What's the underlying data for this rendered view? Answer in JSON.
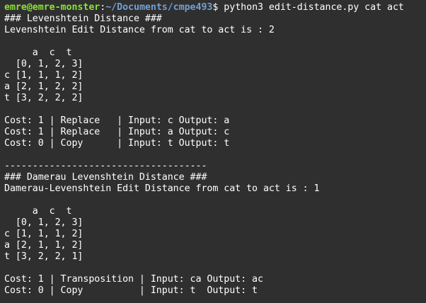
{
  "prompt": {
    "user_host": "emre@emre-monster",
    "separator": ":",
    "path": "~/Documents/cmpe493",
    "symbol_and_command": "$ python3 edit-distance.py cat act"
  },
  "colors": {
    "background": "#2f2f2f",
    "text": "#ffffff",
    "user_host": "#8ae234",
    "path": "#729fcf"
  },
  "output_lines": [
    "### Levenshtein Distance ###",
    "Levenshtein Edit Distance from cat to act is : 2",
    "",
    "     a  c  t",
    "  [0, 1, 2, 3]",
    "c [1, 1, 1, 2]",
    "a [2, 1, 2, 2]",
    "t [3, 2, 2, 2]",
    "",
    "Cost: 1 | Replace   | Input: c Output: a",
    "Cost: 1 | Replace   | Input: a Output: c",
    "Cost: 0 | Copy      | Input: t Output: t",
    "",
    "------------------------------------",
    "### Damerau Levenshtein Distance ###",
    "Damerau-Levenshtein Edit Distance from cat to act is : 1",
    "",
    "     a  c  t",
    "  [0, 1, 2, 3]",
    "c [1, 1, 1, 2]",
    "a [2, 1, 1, 2]",
    "t [3, 2, 2, 1]",
    "",
    "Cost: 1 | Transposition | Input: ca Output: ac",
    "Cost: 0 | Copy          | Input: t  Output: t"
  ]
}
